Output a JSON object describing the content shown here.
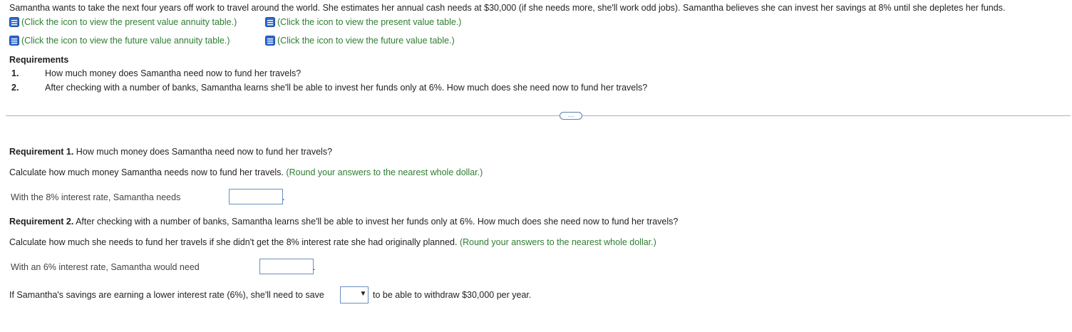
{
  "intro": {
    "text": "Samantha wants to take the next four years off work to travel around the world. She estimates her annual cash needs at $30,000 (if she needs more, she'll work odd jobs). Samantha believes she can invest her savings at 8% until she depletes her funds."
  },
  "links": {
    "pv_annuity": "(Click the icon to view the present value annuity table.)",
    "pv": "(Click the icon to view the present value table.)",
    "fv_annuity": "(Click the icon to view the future value annuity table.)",
    "fv": "(Click the icon to view the future value table.)"
  },
  "requirements": {
    "heading": "Requirements",
    "items": [
      {
        "num": "1.",
        "text": "How much money does Samantha need now to fund her travels?"
      },
      {
        "num": "2.",
        "text": "After checking with a number of banks, Samantha learns she'll be able to invest her funds only at 6%. How much does she need now to fund her travels?"
      }
    ]
  },
  "req1": {
    "label": "Requirement 1.",
    "question": " How much money does Samantha need now to fund her travels?",
    "instruction": "Calculate how much money Samantha needs now to fund her travels.",
    "round_note": "(Round your answers to the nearest whole dollar.)",
    "answer_label": "With the 8% interest rate, Samantha needs",
    "answer_value": "",
    "answer_suffix": "."
  },
  "req2": {
    "label": "Requirement 2.",
    "question": " After checking with a number of banks, Samantha learns she'll be able to invest her funds only at 6%. How much does she need now to fund her travels?",
    "instruction": "Calculate how much she needs to fund her travels if she didn't get the 8% interest rate she had originally planned.",
    "round_note": "(Round your answers to the nearest whole dollar.)",
    "answer_label": "With an 6% interest rate, Samantha would need",
    "answer_value": "",
    "answer_suffix": ".",
    "comparison_prefix": "If Samantha's savings are earning a lower interest rate (6%), she'll need to save",
    "comparison_selected": "",
    "comparison_suffix": "to be able to withdraw $30,000 per year."
  },
  "ui": {
    "ellipsis": "…"
  }
}
